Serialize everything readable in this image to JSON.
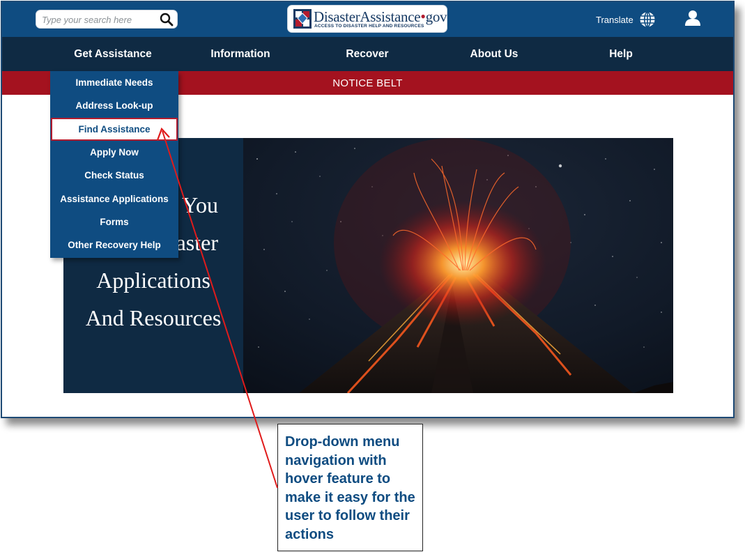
{
  "header": {
    "search_placeholder": "Type your search here",
    "logo": {
      "name_part1": "Disaster",
      "name_part2": "Assistance",
      "dot": "•",
      "tld": "gov",
      "tagline": "ACCESS TO DISASTER HELP AND RESOURCES"
    },
    "translate_label": "Translate"
  },
  "nav": {
    "items": [
      {
        "label": "Get Assistance"
      },
      {
        "label": "Information"
      },
      {
        "label": "Recover"
      },
      {
        "label": "About Us"
      },
      {
        "label": "Help"
      }
    ]
  },
  "notice": {
    "text": "NOTICE BELT"
  },
  "dropdown": {
    "items": [
      {
        "label": "Immediate Needs"
      },
      {
        "label": "Address Look-up"
      },
      {
        "label": "Find Assistance",
        "active": true
      },
      {
        "label": "Apply Now"
      },
      {
        "label": "Check Status"
      },
      {
        "label": "Assistance Applications"
      },
      {
        "label": "Forms"
      },
      {
        "label": "Other Recovery Help"
      }
    ]
  },
  "hero": {
    "lines": [
      "You",
      "aster",
      "Applications",
      "And Resources"
    ]
  },
  "annotation": {
    "text": "Drop-down menu navigation with hover feature to make it easy for the user to follow their actions"
  },
  "colors": {
    "header_blue": "#0f4c81",
    "nav_dark": "#0f2a43",
    "notice_red": "#a4121f",
    "arrow_red": "#e01b1b"
  },
  "icons": {
    "search": "magnifier-icon",
    "translate": "globe-icon",
    "user": "user-icon"
  }
}
